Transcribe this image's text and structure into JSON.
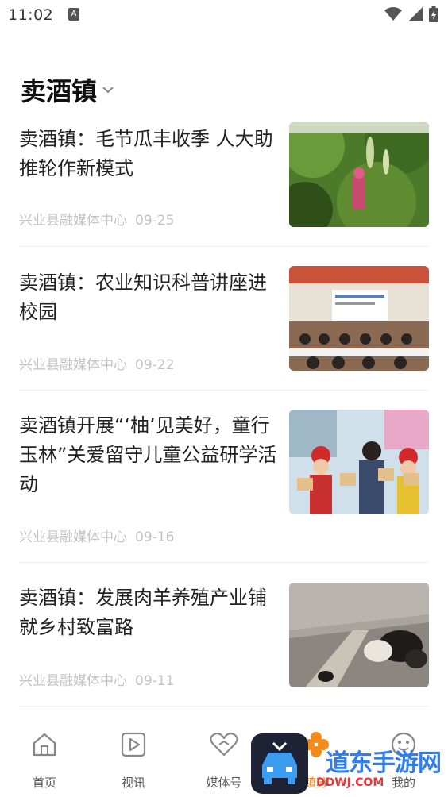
{
  "status_bar": {
    "time": "11:02",
    "notification_letter": "A"
  },
  "channel": {
    "title": "卖酒镇"
  },
  "articles": [
    {
      "title": "卖酒镇：毛节瓜丰收季 人大助推轮作新模式",
      "source": "兴业县融媒体中心",
      "date": "09-25"
    },
    {
      "title": "卖酒镇：农业知识科普讲座进校园",
      "source": "兴业县融媒体中心",
      "date": "09-22"
    },
    {
      "title": "卖酒镇开展“‘柚’见美好，童行玉林”关爱留守儿童公益研学活动",
      "source": "兴业县融媒体中心",
      "date": "09-16"
    },
    {
      "title": "卖酒镇：发展肉羊养殖产业铺就乡村致富路",
      "source": "兴业县融媒体中心",
      "date": "09-11"
    }
  ],
  "tabbar": {
    "tabs": [
      {
        "label": "首页",
        "icon": "home-icon"
      },
      {
        "label": "视讯",
        "icon": "video-icon"
      },
      {
        "label": "媒体号",
        "icon": "heart-icon"
      },
      {
        "label": "镇分",
        "icon": "flower-icon"
      },
      {
        "label": "我的",
        "icon": "smile-icon"
      }
    ]
  },
  "watermark": {
    "text": "道东手游网",
    "url": "DDWJ.COM"
  },
  "colors": {
    "meta_text": "#c2c2c2",
    "divider": "#eeeeee",
    "watermark": "#2f7df0"
  }
}
